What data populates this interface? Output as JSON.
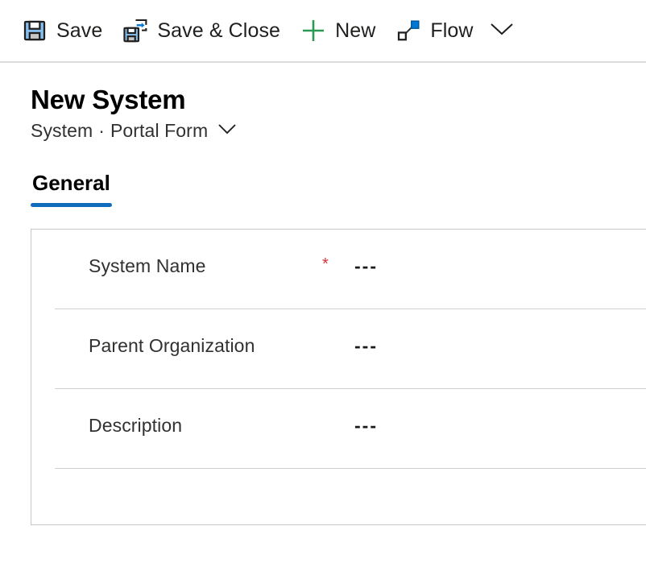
{
  "command_bar": {
    "buttons": [
      {
        "id": "save",
        "label": "Save",
        "icon": "save-floppy-icon"
      },
      {
        "id": "save-close",
        "label": "Save & Close",
        "icon": "save-and-close-icon"
      },
      {
        "id": "new",
        "label": "New",
        "icon": "plus-icon"
      },
      {
        "id": "flow",
        "label": "Flow",
        "icon": "flow-icon"
      }
    ],
    "overflow_icon": "chevron-down-icon"
  },
  "header": {
    "title": "New System",
    "entity": "System",
    "separator": "·",
    "form_name": "Portal Form",
    "form_chevron_icon": "chevron-down-icon"
  },
  "tabs": [
    {
      "id": "general",
      "label": "General",
      "selected": true,
      "accent": "#0f6cbd"
    }
  ],
  "form": {
    "fields": [
      {
        "name": "system-name",
        "label": "System Name",
        "required": true,
        "required_marker": "*",
        "value": "---"
      },
      {
        "name": "parent-organization",
        "label": "Parent Organization",
        "required": false,
        "required_marker": "",
        "value": "---"
      },
      {
        "name": "description",
        "label": "Description",
        "required": false,
        "required_marker": "",
        "value": "---"
      }
    ]
  },
  "colors": {
    "accent_blue": "#0f6cbd",
    "icon_blue": "#0078d4",
    "icon_light_blue": "#86bfee",
    "icon_dark": "#1f1f1f",
    "green": "#2a9a52",
    "required_red": "#d13438",
    "border_gray": "#c8c6c4",
    "separator_gray": "#d2d0ce",
    "toolbar_divider": "#dadada"
  }
}
